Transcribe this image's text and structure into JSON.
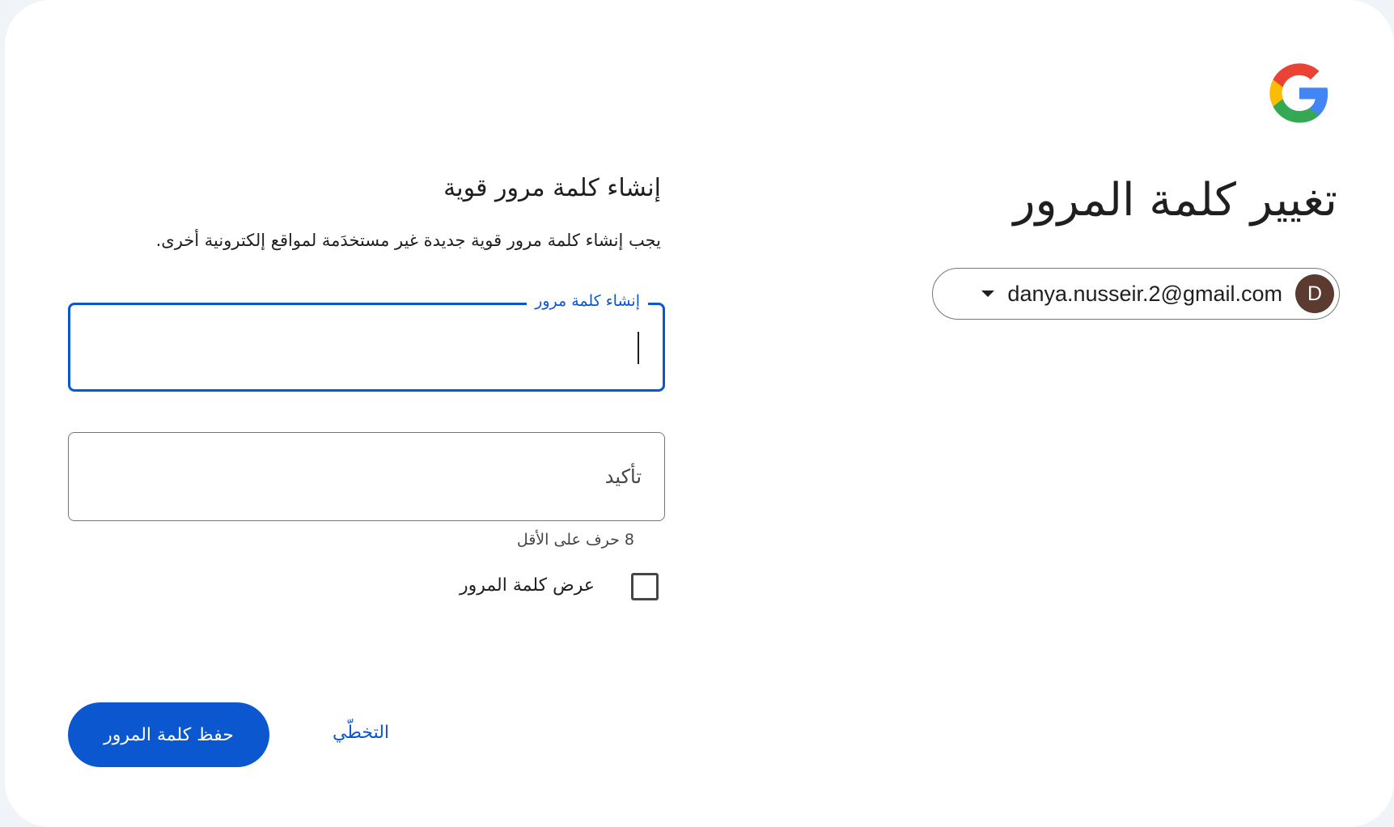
{
  "header": {
    "title": "تغيير كلمة المرور"
  },
  "account": {
    "email": "danya.nusseir.2@gmail.com",
    "avatar_initial": "D",
    "avatar_color": "#5b3b2f"
  },
  "form": {
    "heading": "إنشاء كلمة مرور قوية",
    "description": "يجب إنشاء كلمة مرور قوية جديدة غير مستخدَمة لمواقع إلكترونية أخرى.",
    "new_password": {
      "label": "إنشاء كلمة مرور",
      "value": ""
    },
    "confirm_password": {
      "placeholder": "تأكيد",
      "value": ""
    },
    "hint": "8 حرف على الأقل",
    "show_password": {
      "label": "عرض كلمة المرور",
      "checked": false
    },
    "save_label": "حفظ كلمة المرور",
    "skip_label": "التخطّي"
  },
  "colors": {
    "accent": "#0b57d0",
    "background": "#f0f4f9",
    "card": "#ffffff"
  },
  "icons": {
    "logo": "google-logo-icon",
    "dropdown": "caret-down-icon"
  }
}
